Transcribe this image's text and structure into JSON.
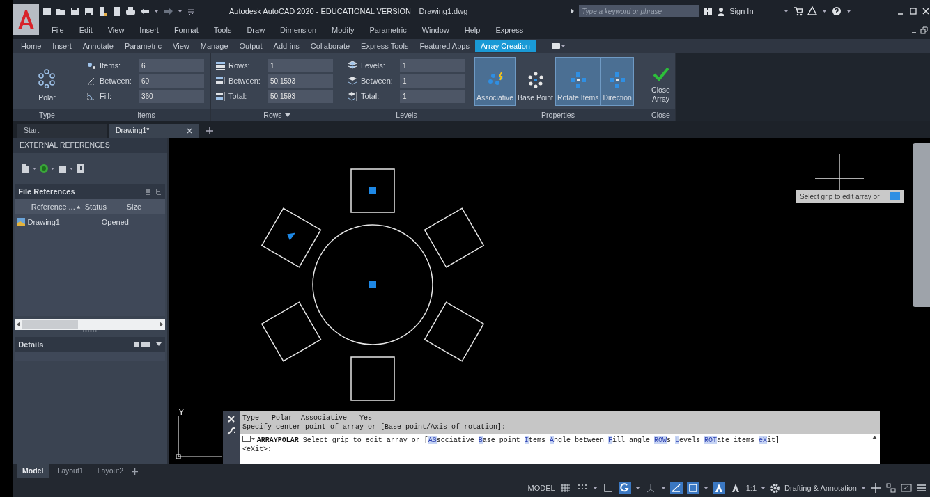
{
  "app_title": "Autodesk AutoCAD 2020 - EDUCATIONAL VERSION",
  "file_name": "Drawing1.dwg",
  "search": {
    "placeholder": "Type a keyword or phrase"
  },
  "sign_in": "Sign In",
  "menu": [
    "File",
    "Edit",
    "View",
    "Insert",
    "Format",
    "Tools",
    "Draw",
    "Dimension",
    "Modify",
    "Parametric",
    "Window",
    "Help",
    "Express"
  ],
  "ribbon_tabs": [
    {
      "label": "Home",
      "selected": false
    },
    {
      "label": "Insert",
      "selected": false
    },
    {
      "label": "Annotate",
      "selected": false
    },
    {
      "label": "Parametric",
      "selected": false
    },
    {
      "label": "View",
      "selected": false
    },
    {
      "label": "Manage",
      "selected": false
    },
    {
      "label": "Output",
      "selected": false
    },
    {
      "label": "Add-ins",
      "selected": false
    },
    {
      "label": "Collaborate",
      "selected": false
    },
    {
      "label": "Express Tools",
      "selected": false
    },
    {
      "label": "Featured Apps",
      "selected": false
    },
    {
      "label": "Array Creation",
      "selected": true
    }
  ],
  "ribbon_panels": [
    {
      "kind": "type",
      "title": "Type",
      "dropdown": false,
      "button": "Polar"
    },
    {
      "kind": "fields",
      "title": "Items",
      "dropdown": false,
      "fields": [
        {
          "label": "Items:",
          "value": "6"
        },
        {
          "label": "Between:",
          "value": "60"
        },
        {
          "label": "Fill:",
          "value": "360"
        }
      ]
    },
    {
      "kind": "fields",
      "title": "Rows",
      "dropdown": true,
      "fields": [
        {
          "label": "Rows:",
          "value": "1"
        },
        {
          "label": "Between:",
          "value": "50.1593"
        },
        {
          "label": "Total:",
          "value": "50.1593"
        }
      ]
    },
    {
      "kind": "fields",
      "title": "Levels",
      "dropdown": false,
      "fields": [
        {
          "label": "Levels:",
          "value": "1"
        },
        {
          "label": "Between:",
          "value": "1"
        },
        {
          "label": "Total:",
          "value": "1"
        }
      ]
    },
    {
      "kind": "toggles",
      "title": "Properties",
      "dropdown": false,
      "buttons": [
        {
          "label": "Associative",
          "selected": true
        },
        {
          "label": "Base Point",
          "selected": false
        },
        {
          "label": "Rotate Items",
          "selected": true
        },
        {
          "label": "Direction",
          "selected": true
        }
      ]
    },
    {
      "kind": "close",
      "title": "Close",
      "dropdown": false,
      "button": "Close Array"
    }
  ],
  "doc_tabs": [
    {
      "label": "Start",
      "selected": false,
      "closable": false
    },
    {
      "label": "Drawing1*",
      "selected": true,
      "closable": true
    }
  ],
  "xref_palette": {
    "title": "EXTERNAL REFERENCES",
    "section": "File References",
    "columns": [
      "Reference ...",
      "Status",
      "Size"
    ],
    "rows": [
      {
        "name": "Drawing1",
        "status": "Opened"
      }
    ],
    "details": "Details"
  },
  "canvas": {
    "axis_label": "Y",
    "tooltip": "Select grip to edit array or"
  },
  "command_line": {
    "history": [
      "Type = Polar  Associative = Yes",
      "Specify center point of array or [Base point/Axis of rotation]:"
    ],
    "prompt": [
      {
        "kind": "command",
        "text": "ARRAYPOLAR"
      },
      {
        "kind": "plain",
        "text": " Select grip to edit array or ["
      },
      {
        "kind": "key",
        "text": "AS"
      },
      {
        "kind": "plain",
        "text": "sociative "
      },
      {
        "kind": "key",
        "text": "B"
      },
      {
        "kind": "plain",
        "text": "ase point "
      },
      {
        "kind": "key",
        "text": "I"
      },
      {
        "kind": "plain",
        "text": "tems "
      },
      {
        "kind": "key",
        "text": "A"
      },
      {
        "kind": "plain",
        "text": "ngle between "
      },
      {
        "kind": "key",
        "text": "F"
      },
      {
        "kind": "plain",
        "text": "ill angle "
      },
      {
        "kind": "key",
        "text": "ROW"
      },
      {
        "kind": "plain",
        "text": "s "
      },
      {
        "kind": "key",
        "text": "L"
      },
      {
        "kind": "plain",
        "text": "evels "
      },
      {
        "kind": "key",
        "text": "ROT"
      },
      {
        "kind": "plain",
        "text": "ate items "
      },
      {
        "kind": "key",
        "text": "eX"
      },
      {
        "kind": "plain",
        "text": "it]"
      }
    ],
    "prompt_tail": "<eXit>:"
  },
  "layout_tabs": [
    {
      "label": "Model",
      "selected": true
    },
    {
      "label": "Layout1",
      "selected": false
    },
    {
      "label": "Layout2",
      "selected": false
    }
  ],
  "status_bar": {
    "model": "MODEL",
    "toggles": [
      {
        "kind": "grid",
        "on": false
      },
      {
        "kind": "snap",
        "on": false
      },
      {
        "kind": "ortho",
        "on": false
      },
      {
        "kind": "polar",
        "on": true
      },
      {
        "kind": "isodraft",
        "on": false
      },
      {
        "kind": "tracking",
        "on": true
      },
      {
        "kind": "osnap",
        "on": true
      },
      {
        "kind": "annoscale",
        "on": true
      },
      {
        "kind": "annovisible",
        "on": false
      }
    ],
    "scale": "1:1",
    "workspace": "Drafting & Annotation"
  }
}
